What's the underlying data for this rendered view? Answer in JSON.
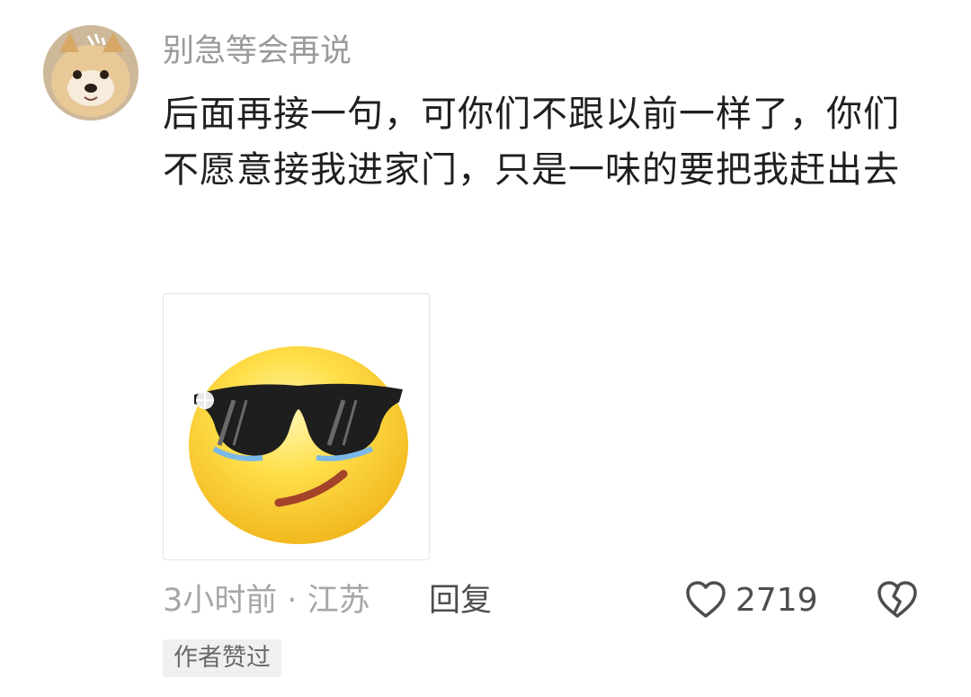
{
  "comment": {
    "username": "别急等会再说",
    "text": "后面再接一句，可你们不跟以前一样了，你们不愿意接我进家门，只是一味的要把我赶出去",
    "sticker_icon": "cool-sunglasses-emoji-icon",
    "meta": "3小时前 · 江苏",
    "reply_label": "回复",
    "like_count": "2719",
    "author_liked_badge": "作者赞过"
  },
  "colors": {
    "text": "#1f1f1f",
    "secondary": "#9a9a9a",
    "badge_bg": "#f0f0f0"
  }
}
